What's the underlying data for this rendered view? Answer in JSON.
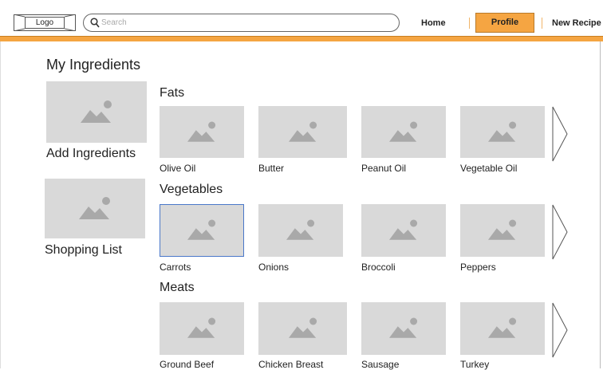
{
  "header": {
    "logo_label": "Logo",
    "search_placeholder": "Search",
    "nav": {
      "home": "Home",
      "profile": "Profile",
      "new_recipe": "New Recipe"
    },
    "accent_color": "#f5a542"
  },
  "main": {
    "title": "My Ingredients",
    "side_actions": [
      {
        "label": "Add Ingredients"
      },
      {
        "label": "Shopping List"
      }
    ],
    "categories": [
      {
        "name": "Fats",
        "items": [
          "Olive Oil",
          "Butter",
          "Peanut Oil",
          "Vegetable Oil"
        ]
      },
      {
        "name": "Vegetables",
        "items": [
          "Carrots",
          "Onions",
          "Broccoli",
          "Peppers"
        ],
        "selected_item": "Carrots"
      },
      {
        "name": "Meats",
        "items": [
          "Ground Beef",
          "Chicken Breast",
          "Sausage",
          "Turkey"
        ]
      }
    ]
  }
}
